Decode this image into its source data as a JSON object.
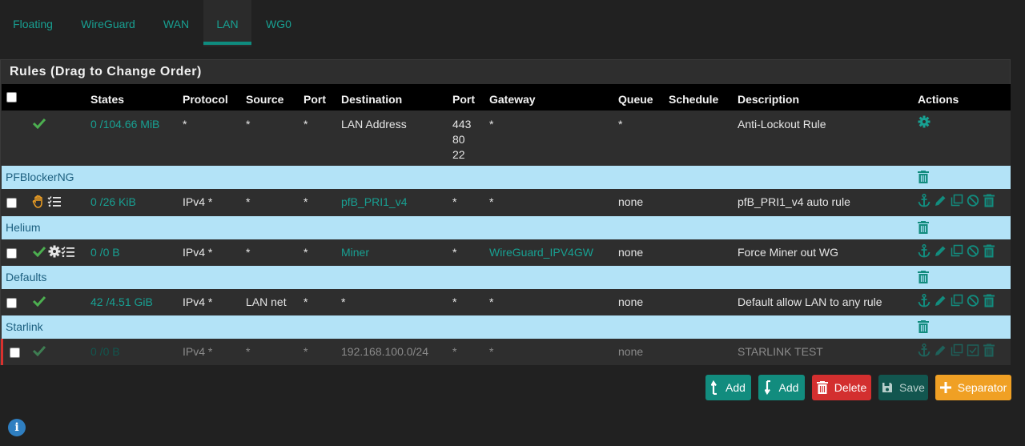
{
  "tabs": [
    {
      "label": "Floating"
    },
    {
      "label": "WireGuard"
    },
    {
      "label": "WAN"
    },
    {
      "label": "LAN"
    },
    {
      "label": "WG0"
    }
  ],
  "active_tab": "LAN",
  "panel": {
    "title": "Rules (Drag to Change Order)"
  },
  "columns": {
    "states": "States",
    "protocol": "Protocol",
    "source": "Source",
    "port": "Port",
    "destination": "Destination",
    "dport": "Port",
    "gateway": "Gateway",
    "queue": "Queue",
    "schedule": "Schedule",
    "description": "Description",
    "actions": "Actions"
  },
  "rows": [
    {
      "states": "0 /104.66 MiB",
      "protocol": "*",
      "source": "*",
      "port": "*",
      "destination": "LAN Address",
      "dport": [
        "443",
        "80",
        "22"
      ],
      "gateway": "*",
      "queue": "*",
      "schedule": "",
      "description": "Anti-Lockout Rule"
    },
    {
      "states": "0 /26 KiB",
      "protocol": "IPv4 *",
      "source": "*",
      "port": "*",
      "destination": "pfB_PRI1_v4",
      "dport": "*",
      "gateway": "*",
      "queue": "none",
      "schedule": "",
      "description": "pfB_PRI1_v4 auto rule"
    },
    {
      "states": "0 /0 B",
      "protocol": "IPv4 *",
      "source": "*",
      "port": "*",
      "destination": "Miner",
      "dport": "*",
      "gateway": "WireGuard_IPV4GW",
      "queue": "none",
      "schedule": "",
      "description": "Force Miner out WG"
    },
    {
      "states": "42 /4.51 GiB",
      "protocol": "IPv4 *",
      "source": "LAN net",
      "port": "*",
      "destination": "*",
      "dport": "*",
      "gateway": "*",
      "queue": "none",
      "schedule": "",
      "description": "Default allow LAN to any rule"
    },
    {
      "states": "0 /0 B",
      "protocol": "IPv4 *",
      "source": "*",
      "port": "*",
      "destination": "192.168.100.0/24",
      "dport": "*",
      "gateway": "*",
      "queue": "none",
      "schedule": "",
      "description": "STARLINK TEST"
    }
  ],
  "separators": [
    {
      "label": "PFBlockerNG"
    },
    {
      "label": "Helium"
    },
    {
      "label": "Defaults"
    },
    {
      "label": "Starlink"
    }
  ],
  "buttons": {
    "add_top": "Add",
    "add_bottom": "Add",
    "delete": "Delete",
    "save": "Save",
    "separator": "Separator"
  },
  "colors": {
    "accent": "#18a092",
    "separator_bg": "#b3e3f7",
    "delete": "#d32f2f",
    "separator_btn": "#f0a024",
    "pass_check": "#4caf50"
  }
}
